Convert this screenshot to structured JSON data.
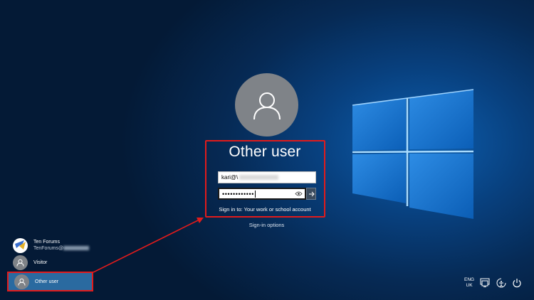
{
  "login": {
    "username": "Other user",
    "user_field_value": "kari@\\",
    "password_masked": "••••••••••••",
    "sign_in_to": "Sign in to: Your work or school account",
    "sign_in_options": "Sign-in options"
  },
  "user_list": [
    {
      "name": "Ten Forums",
      "sub": "TenForums@"
    },
    {
      "name": "Visitor"
    },
    {
      "name": "Other user",
      "selected": true
    }
  ],
  "system_tray": {
    "lang_line1": "ENG",
    "lang_line2": "UK",
    "icons": [
      "network-icon",
      "ease-of-access-icon",
      "power-icon"
    ]
  },
  "colors": {
    "highlight": "#e21b1b",
    "selected_row": "#2a6aa0",
    "avatar_gray": "#7f8388"
  }
}
